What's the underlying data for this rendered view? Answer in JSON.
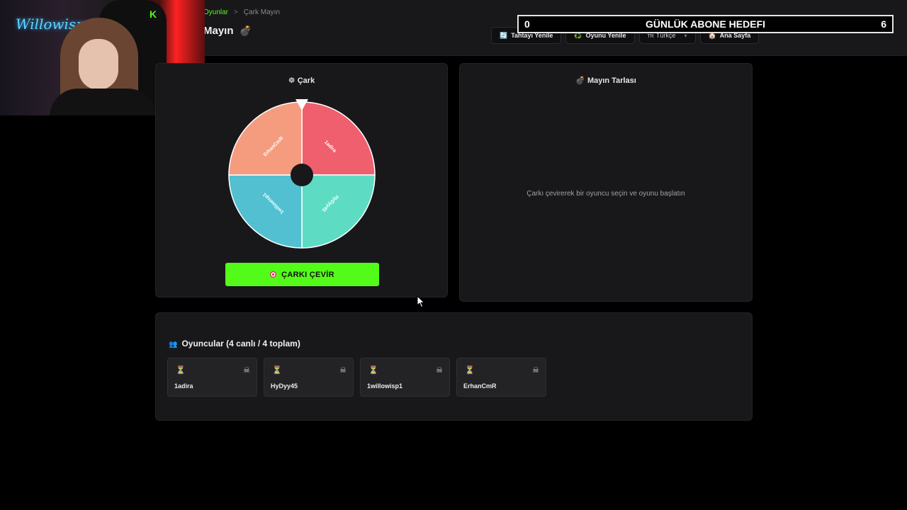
{
  "breadcrumb": {
    "parent": "Oyunlar",
    "separator": ">",
    "current": "Çark Mayın"
  },
  "page_title": "Mayın",
  "top_actions": {
    "refresh_board": "Tahtayı Yenile",
    "refresh_game": "Oyunu Yenile",
    "language_flag": "TR",
    "language": "Türkçe",
    "home": "Ana Sayfa"
  },
  "goal_overlay": {
    "current": "0",
    "label": "GÜNLÜK ABONE HEDEFI",
    "target": "6"
  },
  "wheel_panel": {
    "title": "Çark",
    "segments": [
      {
        "name": "1adira",
        "color": "#f05f6e"
      },
      {
        "name": "HyDyy45",
        "color": "#5ddcc3"
      },
      {
        "name": "1willowisp1",
        "color": "#52c0d0"
      },
      {
        "name": "ErhanCmR",
        "color": "#f59c7f"
      }
    ],
    "spin_label": "ÇARKI ÇEVİR"
  },
  "mine_panel": {
    "title": "Mayın Tarlası",
    "empty_message": "Çarkı çevirerek bir oyuncu seçin ve oyunu başlatın"
  },
  "players": {
    "heading": "Oyuncular (4 canlı / 4 toplam)",
    "items": [
      {
        "name": "1adira"
      },
      {
        "name": "HyDyy45"
      },
      {
        "name": "1willowisp1"
      },
      {
        "name": "ErhanCmR"
      }
    ]
  },
  "colors": {
    "accent": "#53fc18",
    "panel": "#18181b",
    "background": "#000000"
  }
}
